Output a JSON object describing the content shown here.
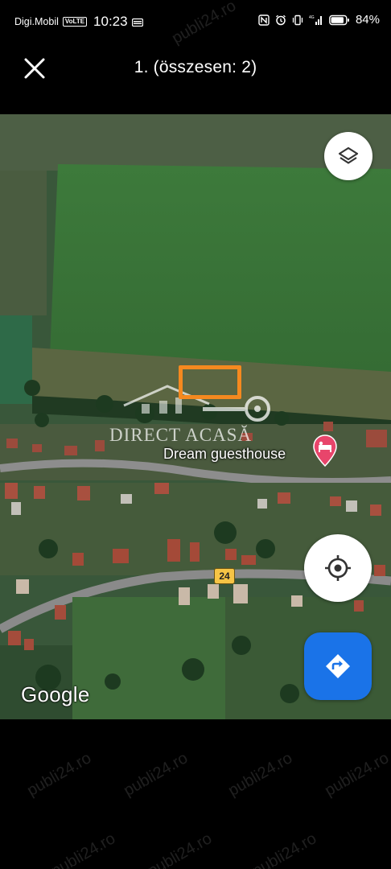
{
  "status_bar": {
    "carrier": "Digi.Mobil",
    "volte": "VoLTE",
    "time": "10:23",
    "battery": "84%"
  },
  "top_bar": {
    "counter": "1. (összesen: 2)"
  },
  "map": {
    "place_label": "Dream guesthouse",
    "road_number": "24",
    "google_logo": "Google",
    "watermark_brand": "DIRECT ACASĂ",
    "watermark_site": "publi24.ro",
    "icons": {
      "close": "close-icon",
      "layers": "layers-icon",
      "locate": "my-location-icon",
      "directions": "directions-icon",
      "pin": "hotel-pin-icon"
    },
    "colors": {
      "directions_blue": "#1a73e8",
      "marker_orange": "#f5891f",
      "pin_pink": "#e8456b"
    }
  }
}
